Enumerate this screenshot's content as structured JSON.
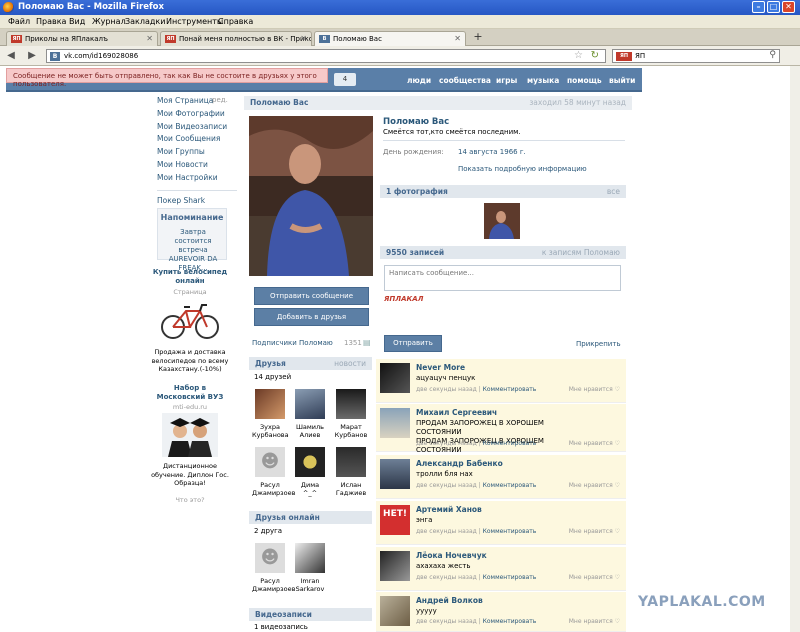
{
  "window": {
    "title": "Поломаю Вас - Mozilla Firefox"
  },
  "menu": [
    "Файл",
    "Правка",
    "Вид",
    "Журнал",
    "Закладки",
    "Инструменты",
    "Справка"
  ],
  "tabs": [
    {
      "label": "Приколы на ЯПлакалъ",
      "fav": "ЯП"
    },
    {
      "label": "Понай меня полностью в ВК - Приколы...",
      "fav": "ЯП"
    },
    {
      "label": "Поломаю Вас",
      "fav": "В"
    }
  ],
  "nav": {
    "url": "vk.com/id169028086",
    "search": "ЯП"
  },
  "alert": "Сообщение не может быть отправлено, так как Вы не состоите в друзьях у этого пользователя.",
  "header": {
    "count": "4",
    "links": [
      "люди",
      "сообщества",
      "игры",
      "музыка",
      "помощь",
      "выйти"
    ]
  },
  "left_menu": {
    "items": [
      "Моя Страница",
      "Мои Фотографии",
      "Мои Видеозаписи",
      "Мои Сообщения",
      "Мои Группы",
      "Мои Новости",
      "Мои Настройки"
    ],
    "edit": "ред.",
    "extra": "Покер Shark"
  },
  "reminder": {
    "title": "Напоминание",
    "text": "Завтра состоится встреча AUREVOIR DA FREAK..."
  },
  "ads": [
    {
      "title": "Купить велосипед онлайн",
      "sub": "Страница",
      "desc": "Продажа и доставка велосипедов по всему Казахстану.(-10%)"
    },
    {
      "title": "Набор в Московский ВУЗ",
      "sub": "mti-edu.ru",
      "desc": "Дистанционное обучение. Диплон Гос. Образца!"
    }
  ],
  "ads_what": "Что это?",
  "profile": {
    "name": "Поломаю Вас",
    "last_seen": "заходил 58 минут назад",
    "status": "Смеётся тот,кто смеётся последним.",
    "birthday_label": "День рождения:",
    "birthday": "14 августа 1966 г.",
    "more": "Показать подробную информацию",
    "send_message": "Отправить сообщение",
    "add_friend": "Добавить в друзья",
    "subscribers": "Подписчики Поломаю",
    "subscribers_count": "1351"
  },
  "photos": {
    "header": "1 фотография",
    "all": "все"
  },
  "friends": {
    "header": "Друзья",
    "news": "новости",
    "count": "14 друзей",
    "list": [
      {
        "first": "Зухра",
        "last": "Курбанова"
      },
      {
        "first": "Шамиль",
        "last": "Алиев"
      },
      {
        "first": "Марат",
        "last": "Курбанов"
      },
      {
        "first": "Расул",
        "last": "Джамирзоев"
      },
      {
        "first": "Дима",
        "last": "^_^"
      },
      {
        "first": "Ислан",
        "last": "Гаджиев"
      }
    ]
  },
  "friends_online": {
    "header": "Друзья онлайн",
    "count": "2 друга",
    "list": [
      {
        "first": "Расул",
        "last": "Джамирзоев"
      },
      {
        "first": "Imran",
        "last": "Sarkarov"
      }
    ]
  },
  "videos": {
    "header": "Видеозаписи",
    "count": "1 видеозапись"
  },
  "wall": {
    "header": "9550 записей",
    "to_posts": "к записям Поломаю",
    "placeholder": "Написать сообщение...",
    "attach_logo": "ЯПЛАКАЛ",
    "send": "Отправить",
    "attach": "Прикрепить",
    "posts": [
      {
        "author": "Never More",
        "text": "ацуацуч пенцук",
        "time": "две секунды назад",
        "comment": "Комментировать",
        "like": "Мне нравится"
      },
      {
        "author": "Михаил Сергеевич",
        "text": "ПРОДАМ ЗАПОРОЖЕЦ В ХОРОШЕМ СОСТОЯНИИ\nПРОДАМ ЗАПОРОЖЕЦ В ХОРОШЕМ СОСТОЯНИИ",
        "time": "две секунды назад",
        "comment": "Комментировать",
        "like": "Мне нравится"
      },
      {
        "author": "Александр Бабенко",
        "text": "тролли бля нах",
        "time": "две секунды назад",
        "comment": "Комментировать",
        "like": "Мне нравится"
      },
      {
        "author": "Артемий Ханов",
        "text": "энга",
        "time": "две секунды назад",
        "comment": "Комментировать",
        "like": "Мне нравится",
        "badge": "НЕТ!"
      },
      {
        "author": "Лёока Ночевчук",
        "text": "ахахаха жесть",
        "time": "две секунды назад",
        "comment": "Комментировать",
        "like": "Мне нравится"
      },
      {
        "author": "Андрей Волков",
        "text": "ууууу",
        "time": "две секунды назад",
        "comment": "Комментировать",
        "like": "Мне нравится"
      }
    ]
  },
  "watermark": "YAPLAKAL.COM"
}
